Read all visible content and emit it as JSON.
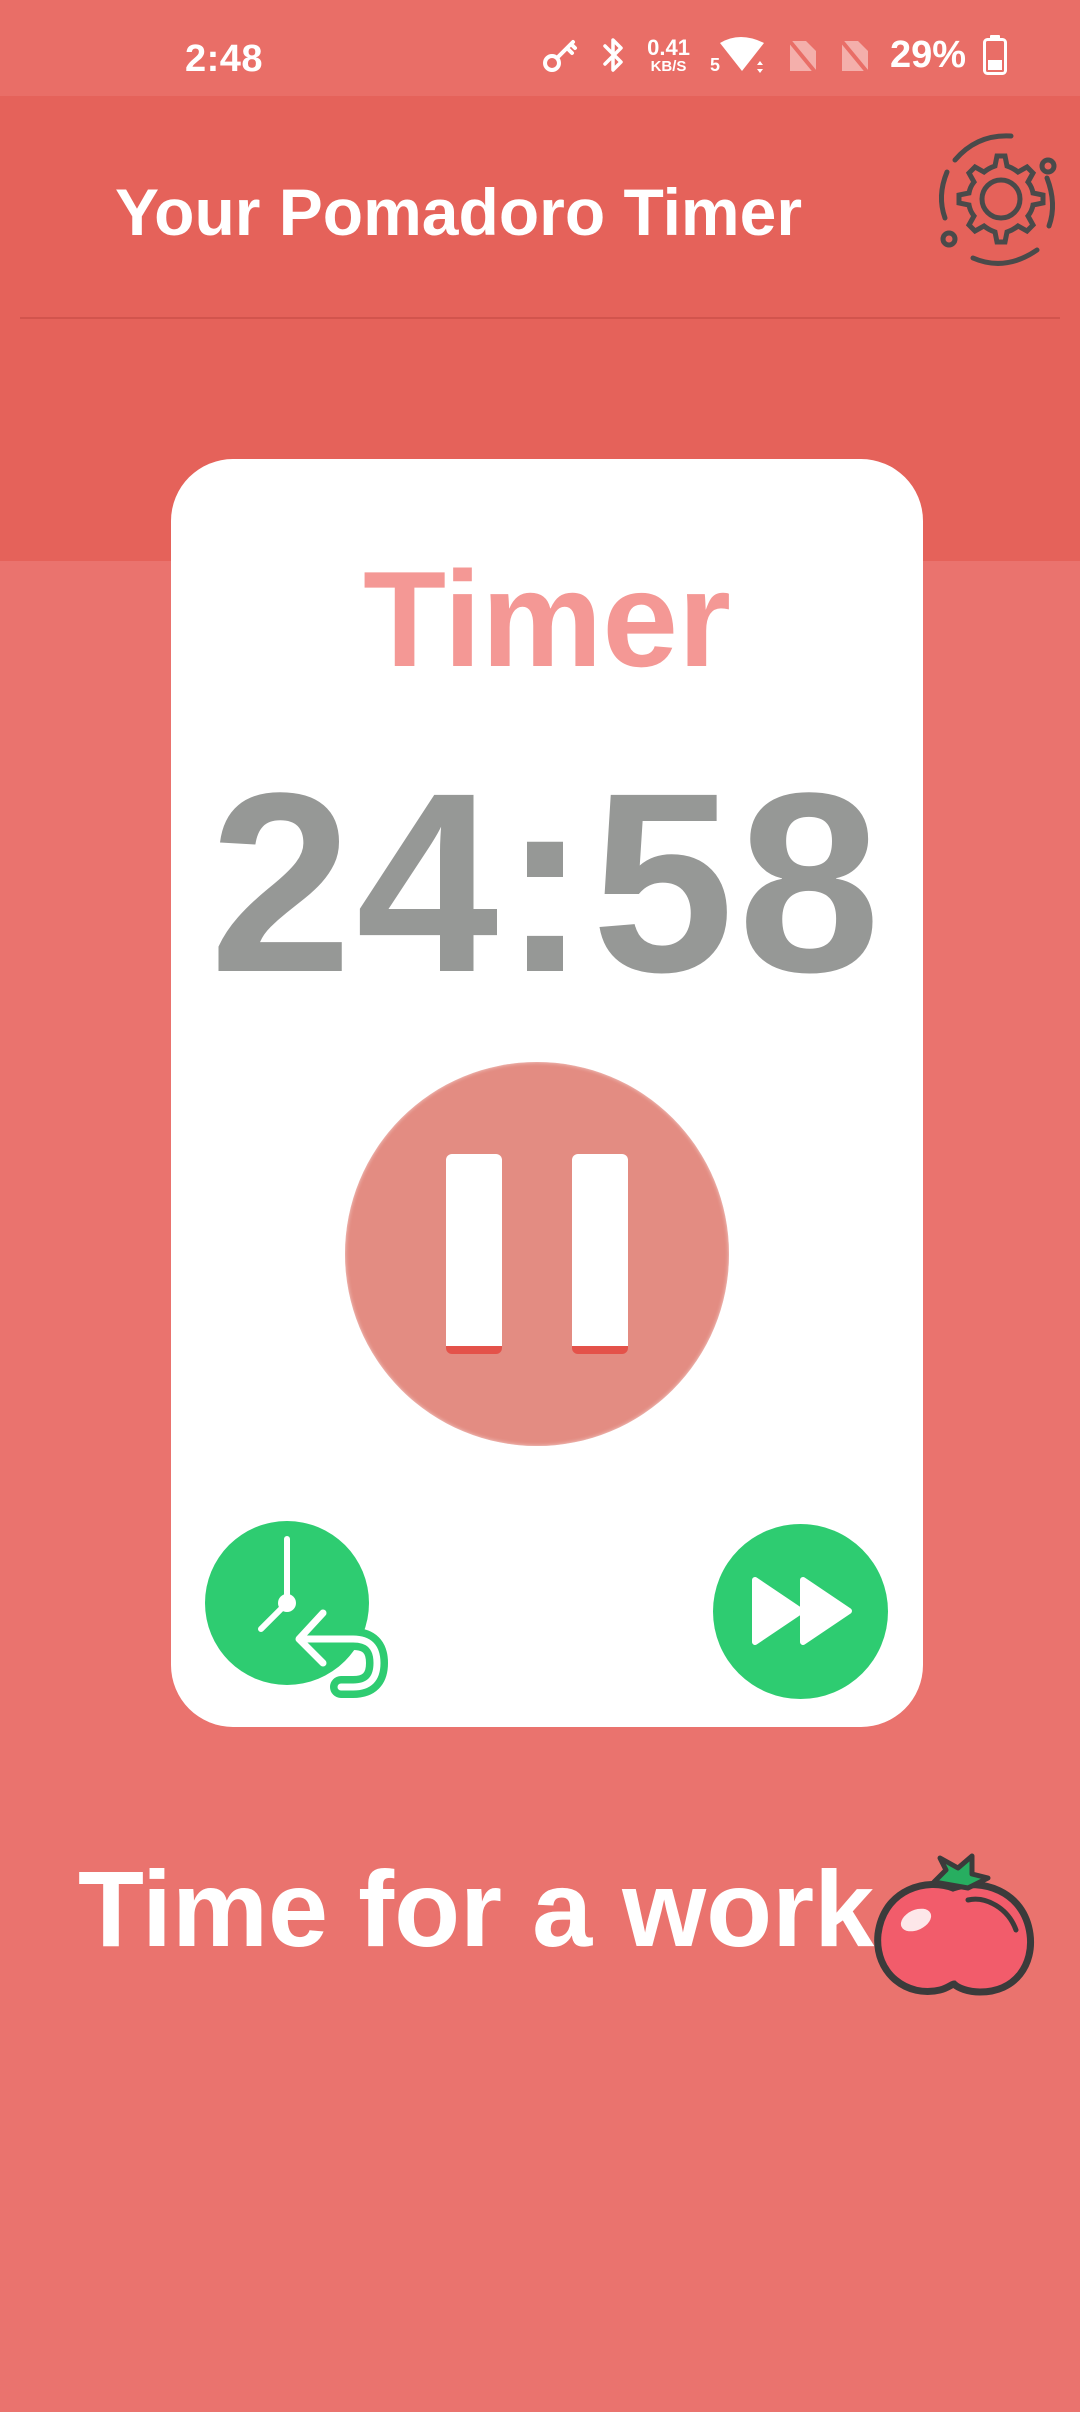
{
  "status_bar": {
    "time": "2:48",
    "net_speed_value": "0.41",
    "net_speed_unit": "KB/S",
    "wifi_sub": "5",
    "battery": "29%"
  },
  "header": {
    "title": "Your Pomadoro Timer",
    "settings_icon": "gear-icon"
  },
  "timer_card": {
    "title": "Timer",
    "time": "24:58",
    "pause_icon": "pause-icon",
    "reset_icon": "clock-reset-icon",
    "skip_icon": "fast-forward-icon"
  },
  "message": {
    "text": "Time for a work",
    "emoji_icon": "tomato-icon"
  },
  "colors": {
    "background": "#EA736E",
    "header": "#E5625A",
    "card": "#FFFFFF",
    "accent_green": "#2ECC71",
    "title_pink": "#F49895",
    "time_gray": "#969896",
    "pause_button": "#E38C82"
  }
}
